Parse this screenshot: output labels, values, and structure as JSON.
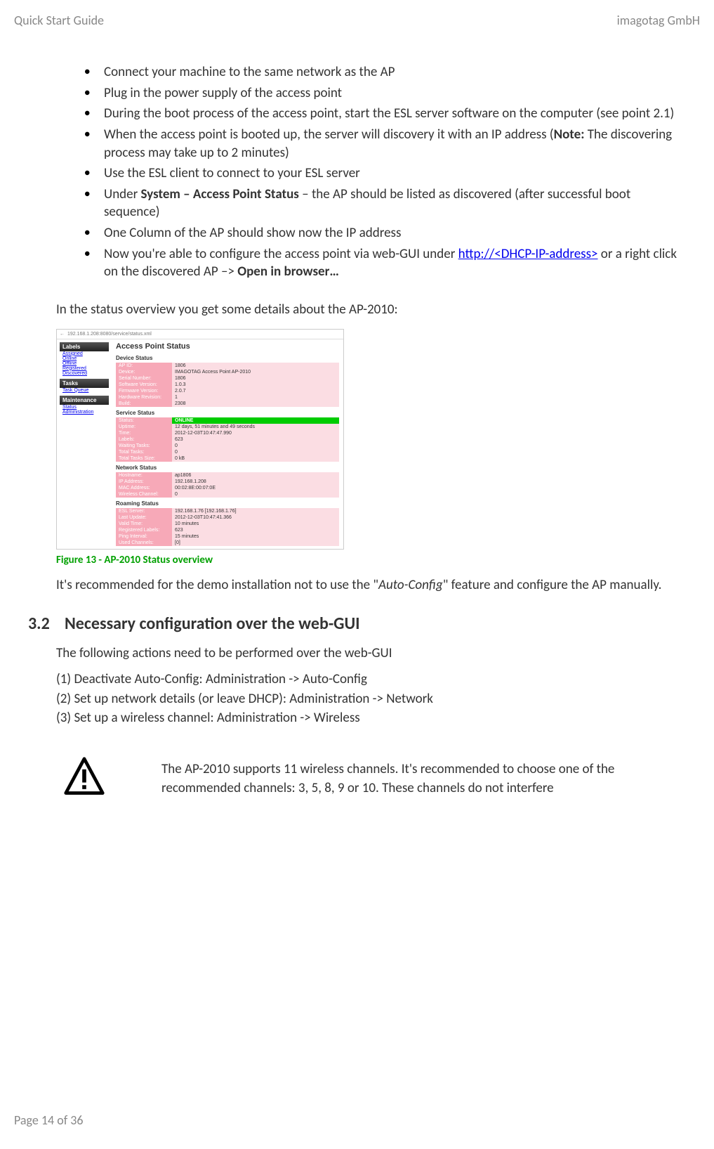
{
  "header": {
    "left": "Quick Start Guide",
    "right": "imagotag GmbH"
  },
  "bullets": [
    {
      "text": "Connect your machine to the same network as the AP"
    },
    {
      "text": "Plug in the power supply of the access point"
    },
    {
      "text": "During the boot process of the access point, start the ESL server software on the computer (see point 2.1)"
    },
    {
      "pre": "When the access point is booted up, the server will discovery it with an IP address (",
      "bold": "Note:",
      "post": " The discovering process may take up to 2 minutes)"
    },
    {
      "text": "Use the ESL client to connect to your ESL server"
    },
    {
      "pre": "Under ",
      "bold": "System – Access Point Status",
      "post": " – the AP should be listed as discovered (after successful boot sequence)"
    },
    {
      "text": "One Column of the AP should show now the IP address"
    },
    {
      "pre": "Now you're able to configure the access point via web-GUI under ",
      "link": "http://<DHCP-IP-address>",
      "post": " or a right click on the discovered AP –> ",
      "bold2": "Open in browser…"
    }
  ],
  "status_intro": "In the status overview you get some details about the AP-2010:",
  "figure": {
    "address": "192.168.1.208:8080/service/status.xml",
    "side": {
      "labels_head": "Labels",
      "labels": [
        "Assigned",
        "Online",
        "Offline",
        "Registered",
        "Discovered"
      ],
      "tasks_head": "Tasks",
      "tasks": [
        "Task Queue"
      ],
      "maint_head": "Maintenance",
      "maint": [
        "Status",
        "Administration"
      ]
    },
    "main_title": "Access Point Status",
    "device_head": "Device Status",
    "device": [
      [
        "AP ID:",
        "1806"
      ],
      [
        "Device:",
        "IMAGOTAG Access Point AP-2010"
      ],
      [
        "Serial Number:",
        "1806"
      ],
      [
        "Software Version:",
        "1.0.3"
      ],
      [
        "Firmware Version:",
        "2.0.7"
      ],
      [
        "Hardware Revision:",
        "1"
      ],
      [
        "Build:",
        "2308"
      ]
    ],
    "service_head": "Service Status",
    "service_status": [
      "Status:",
      "ONLINE"
    ],
    "service": [
      [
        "Uptime:",
        "12 days, 51 minutes and 49 seconds"
      ],
      [
        "Time:",
        "2012-12-03T10:47:47.990"
      ],
      [
        "Labels:",
        "623"
      ],
      [
        "Waiting Tasks:",
        "0"
      ],
      [
        "Total Tasks:",
        "0"
      ],
      [
        "Total Tasks Size:",
        "0 kB"
      ]
    ],
    "network_head": "Network Status",
    "network": [
      [
        "Hostname:",
        "ap1806"
      ],
      [
        "IP Address:",
        "192.168.1.208"
      ],
      [
        "MAC Address:",
        "00:02:8E:00:07:0E"
      ],
      [
        "Wireless Channel:",
        "0"
      ]
    ],
    "roaming_head": "Roaming Status",
    "roaming": [
      [
        "ESL Server:",
        "192.168.1.76 [192.168.1.76]"
      ],
      [
        "Last Update:",
        "2012-12-03T10:47:41.366"
      ],
      [
        "Valid Time:",
        "10 minutes"
      ],
      [
        "Registered Labels:",
        "623"
      ],
      [
        "Ping Interval:",
        "15 minutes"
      ],
      [
        "Used Channels:",
        "[0]"
      ]
    ]
  },
  "caption": "Figure 13 - AP-2010 Status overview",
  "recommend_pre": "It's recommended for the demo installation not to use the \"",
  "recommend_em": "Auto-Config",
  "recommend_post": "\" feature and configure the AP manually.",
  "section": {
    "num": "3.2",
    "title": "Necessary configuration over the web-GUI"
  },
  "section_intro": "The following actions need to be performed over the web-GUI",
  "steps": [
    "(1) Deactivate Auto-Config: Administration -> Auto-Config",
    "(2) Set up network details (or leave DHCP): Administration -> Network",
    "(3) Set up a wireless channel: Administration -> Wireless"
  ],
  "warning": "The AP-2010 supports 11 wireless channels. It's recommended to choose one of the recommended channels: 3, 5, 8, 9 or 10. These channels do not interfere",
  "footer": "Page 14 of 36"
}
